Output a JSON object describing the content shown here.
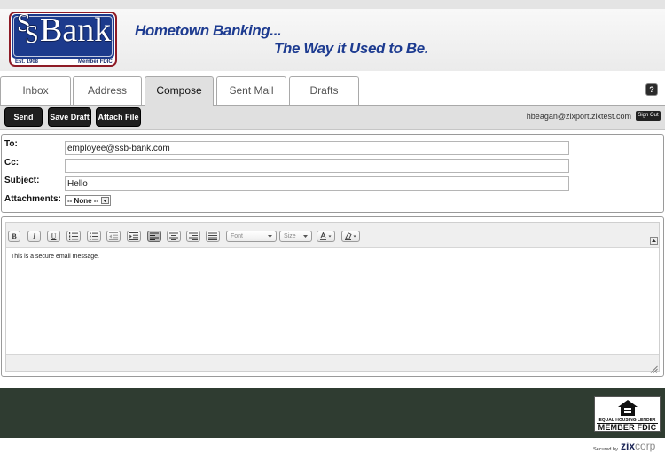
{
  "colors": {
    "brand_navy": "#1c3a8c",
    "brand_red": "#8e1b26",
    "tagline_blue": "#1d3b90",
    "action_button": "#1f1f1f",
    "toolbar_bg": "#e0e0e0",
    "footer_bg": "#2f3c31"
  },
  "header": {
    "logo": {
      "mark_1": "S",
      "mark_2": "S",
      "word": "Bank",
      "est": "Est. 1908",
      "fdic": "Member FDIC"
    },
    "tagline": {
      "line1": "Hometown Banking...",
      "line2": "The Way it Used to Be."
    }
  },
  "tabs": [
    {
      "label": "Inbox",
      "active": false
    },
    {
      "label": "Address",
      "active": false
    },
    {
      "label": "Compose",
      "active": true
    },
    {
      "label": "Sent Mail",
      "active": false
    },
    {
      "label": "Drafts",
      "active": false
    }
  ],
  "help": {
    "glyph": "?",
    "icon": "help-icon"
  },
  "toolbar": {
    "send_label": "Send",
    "save_draft_label": "Save Draft",
    "attach_file_label": "Attach File",
    "user_email": "hbeagan@zixport.zixtest.com",
    "sign_out_label": "Sign Out"
  },
  "compose_form": {
    "to": {
      "label": "To:",
      "value": "employee@ssb-bank.com"
    },
    "cc": {
      "label": "Cc:",
      "value": ""
    },
    "subject": {
      "label": "Subject:",
      "value": "Hello"
    },
    "attachments": {
      "label": "Attachments:",
      "selected": "-- None --"
    }
  },
  "editor": {
    "toolbar": {
      "bold": "B",
      "italic": "I",
      "underline": "U",
      "font_placeholder": "Font",
      "size_placeholder": "Size",
      "icons": [
        "bold-icon",
        "italic-icon",
        "underline-icon",
        "ordered-list-icon",
        "unordered-list-icon",
        "outdent-icon",
        "indent-icon",
        "align-left-icon",
        "align-center-icon",
        "align-right-icon",
        "justify-icon",
        "font-select",
        "size-select",
        "text-color-icon",
        "background-color-icon"
      ],
      "pressed_icon": "align-left-icon"
    },
    "body_text": "This is a secure email message."
  },
  "footer": {
    "ehl_line1": "EQUAL HOUSING LENDER",
    "ehl_line2": "MEMBER FDIC",
    "secured_by": "Secured by",
    "brand_zix": "zix",
    "brand_corp": "corp"
  }
}
